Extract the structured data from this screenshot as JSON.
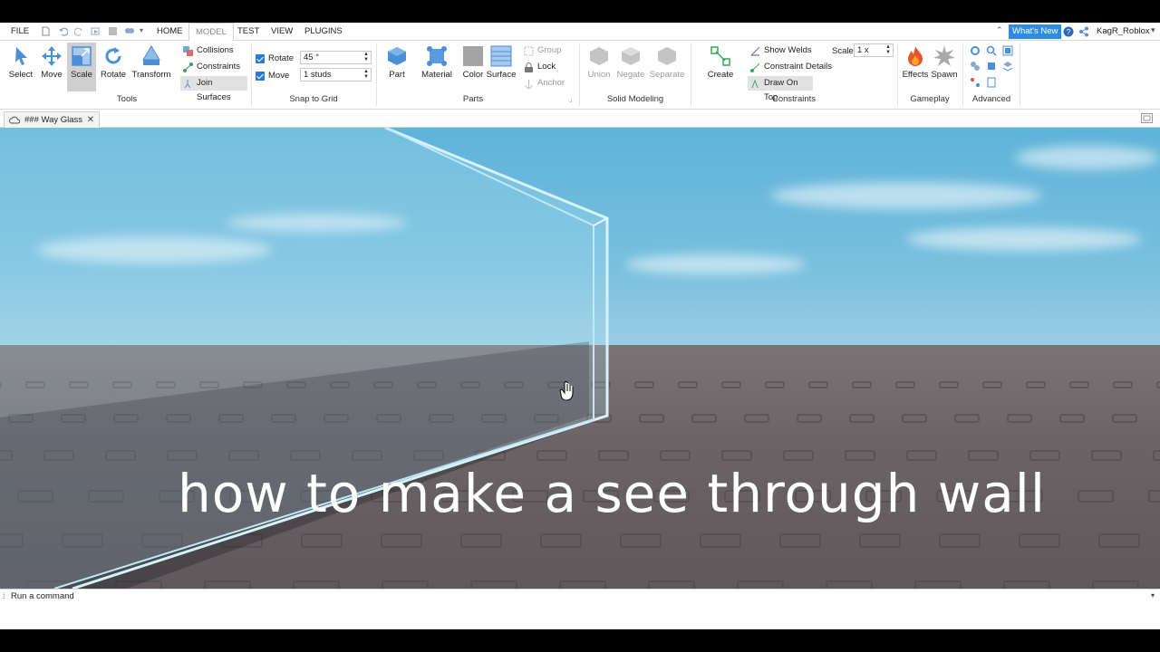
{
  "menubar": {
    "tabs": [
      "FILE",
      "HOME",
      "MODEL",
      "TEST",
      "VIEW",
      "PLUGINS"
    ],
    "active_tab": "MODEL",
    "whats_new": "What's New",
    "username": "KagR_Roblox"
  },
  "ribbon": {
    "tools": {
      "select": "Select",
      "move": "Move",
      "scale": "Scale",
      "rotate": "Rotate",
      "transform": "Transform",
      "collisions": "Collisions",
      "constraints": "Constraints",
      "join_surfaces": "Join Surfaces",
      "group_label": "Tools"
    },
    "snap": {
      "rotate_label": "Rotate",
      "rotate_value": "45 °",
      "move_label": "Move",
      "move_value": "1 studs",
      "group_label": "Snap to Grid"
    },
    "parts": {
      "part": "Part",
      "material": "Material",
      "color": "Color",
      "surface": "Surface",
      "group": "Group",
      "lock": "Lock",
      "anchor": "Anchor",
      "group_label": "Parts"
    },
    "solid": {
      "union": "Union",
      "negate": "Negate",
      "separate": "Separate",
      "group_label": "Solid Modeling"
    },
    "constraints": {
      "create": "Create",
      "show_welds": "Show Welds",
      "constraint_details": "Constraint Details",
      "draw_on_top": "Draw On Top",
      "scale_label": "Scale",
      "scale_value": "1 x",
      "group_label": "Constraints"
    },
    "gameplay": {
      "effects": "Effects",
      "spawn": "Spawn",
      "group_label": "Gameplay"
    },
    "advanced": {
      "group_label": "Advanced"
    }
  },
  "document_tab": {
    "label": "### Way Glass"
  },
  "viewport": {
    "caption": "how to make a see through wall"
  },
  "command_bar": {
    "placeholder": "Run a command"
  },
  "colors": {
    "accent": "#2c8de8",
    "sky_top": "#5fb3d9",
    "ground": "#6b6568"
  }
}
